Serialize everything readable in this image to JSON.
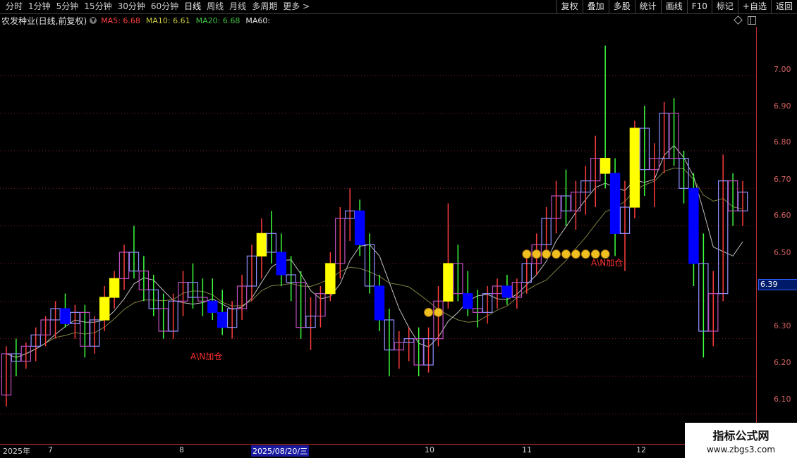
{
  "toolbar": {
    "periods": [
      "分时",
      "1分钟",
      "5分钟",
      "15分钟",
      "30分钟",
      "60分钟",
      "日线",
      "周线",
      "月线",
      "多周期",
      "更多 >"
    ],
    "active_period": "日线",
    "buttons": [
      "复权",
      "叠加",
      "多股",
      "统计",
      "画线",
      "F10",
      "标记",
      "+自选",
      "返回"
    ]
  },
  "info": {
    "stock_title": "农发种业(日线,前复权)",
    "ma5": "MA5: 6.68",
    "ma10": "MA10: 6.61",
    "ma20": "MA20: 6.68",
    "ma60": "MA60:"
  },
  "axis": {
    "dates": [
      "2025年",
      "7",
      "8",
      "10",
      "11",
      "12"
    ],
    "selected_date": "2025/08/20/三",
    "price_ticks": [
      "7.00",
      "6.90",
      "6.80",
      "6.70",
      "6.60",
      "6.50",
      "6.30",
      "6.20",
      "6.10"
    ],
    "current_price": "6.39"
  },
  "chart_data": {
    "type": "candlestick",
    "ylim": [
      6.02,
      7.13
    ],
    "annotations": [
      "A\\N加仓",
      "A\\N加仓"
    ],
    "ma_lines": [
      "MA5",
      "MA10",
      "MA20",
      "MA60"
    ],
    "colors": {
      "up": "#ff3c3c",
      "down": "#3cff3c",
      "box_a": "#c050c0",
      "box_b": "#9090ff",
      "yellow": "#ffff00",
      "blue": "#0000ff",
      "ma": "#a0a060",
      "grid": "#7a2020"
    },
    "ohlc": [
      [
        6.15,
        6.28,
        6.12,
        6.26
      ],
      [
        6.26,
        6.3,
        6.2,
        6.24
      ],
      [
        6.24,
        6.29,
        6.22,
        6.28
      ],
      [
        6.28,
        6.33,
        6.24,
        6.31
      ],
      [
        6.31,
        6.36,
        6.28,
        6.35
      ],
      [
        6.35,
        6.4,
        6.3,
        6.38
      ],
      [
        6.38,
        6.42,
        6.33,
        6.34
      ],
      [
        6.34,
        6.39,
        6.3,
        6.37
      ],
      [
        6.37,
        6.39,
        6.25,
        6.28
      ],
      [
        6.28,
        6.36,
        6.26,
        6.35
      ],
      [
        6.35,
        6.44,
        6.32,
        6.41
      ],
      [
        6.41,
        6.48,
        6.38,
        6.46
      ],
      [
        6.46,
        6.55,
        6.43,
        6.53
      ],
      [
        6.53,
        6.6,
        6.46,
        6.48
      ],
      [
        6.48,
        6.52,
        6.4,
        6.43
      ],
      [
        6.43,
        6.47,
        6.36,
        6.38
      ],
      [
        6.38,
        6.42,
        6.3,
        6.32
      ],
      [
        6.32,
        6.42,
        6.3,
        6.4
      ],
      [
        6.4,
        6.48,
        6.36,
        6.45
      ],
      [
        6.45,
        6.5,
        6.38,
        6.41
      ],
      [
        6.41,
        6.46,
        6.36,
        6.4
      ],
      [
        6.4,
        6.46,
        6.35,
        6.37
      ],
      [
        6.37,
        6.43,
        6.31,
        6.33
      ],
      [
        6.33,
        6.4,
        6.3,
        6.38
      ],
      [
        6.38,
        6.47,
        6.35,
        6.44
      ],
      [
        6.44,
        6.55,
        6.4,
        6.52
      ],
      [
        6.52,
        6.62,
        6.46,
        6.58
      ],
      [
        6.58,
        6.64,
        6.5,
        6.53
      ],
      [
        6.53,
        6.58,
        6.44,
        6.47
      ],
      [
        6.47,
        6.52,
        6.4,
        6.45
      ],
      [
        6.45,
        6.48,
        6.3,
        6.33
      ],
      [
        6.33,
        6.41,
        6.27,
        6.36
      ],
      [
        6.36,
        6.44,
        6.33,
        6.42
      ],
      [
        6.42,
        6.53,
        6.4,
        6.5
      ],
      [
        6.5,
        6.65,
        6.46,
        6.62
      ],
      [
        6.62,
        6.7,
        6.56,
        6.64
      ],
      [
        6.64,
        6.67,
        6.52,
        6.55
      ],
      [
        6.55,
        6.58,
        6.42,
        6.44
      ],
      [
        6.44,
        6.47,
        6.32,
        6.35
      ],
      [
        6.35,
        6.38,
        6.2,
        6.27
      ],
      [
        6.27,
        6.32,
        6.22,
        6.29
      ],
      [
        6.29,
        6.33,
        6.24,
        6.3
      ],
      [
        6.3,
        6.33,
        6.2,
        6.23
      ],
      [
        6.23,
        6.33,
        6.21,
        6.3
      ],
      [
        6.3,
        6.44,
        6.28,
        6.4
      ],
      [
        6.4,
        6.66,
        6.38,
        6.5
      ],
      [
        6.5,
        6.55,
        6.4,
        6.42
      ],
      [
        6.42,
        6.48,
        6.36,
        6.38
      ],
      [
        6.38,
        6.43,
        6.33,
        6.37
      ],
      [
        6.37,
        6.44,
        6.34,
        6.42
      ],
      [
        6.42,
        6.46,
        6.38,
        6.44
      ],
      [
        6.44,
        6.47,
        6.39,
        6.41
      ],
      [
        6.41,
        6.46,
        6.38,
        6.45
      ],
      [
        6.45,
        6.52,
        6.42,
        6.5
      ],
      [
        6.5,
        6.58,
        6.47,
        6.55
      ],
      [
        6.55,
        6.65,
        6.52,
        6.62
      ],
      [
        6.62,
        6.72,
        6.58,
        6.68
      ],
      [
        6.68,
        6.75,
        6.6,
        6.64
      ],
      [
        6.64,
        6.72,
        6.59,
        6.69
      ],
      [
        6.69,
        6.76,
        6.63,
        6.72
      ],
      [
        6.72,
        6.84,
        6.65,
        6.78
      ],
      [
        6.78,
        7.08,
        6.7,
        6.74
      ],
      [
        6.74,
        6.78,
        6.52,
        6.58
      ],
      [
        6.58,
        6.72,
        6.48,
        6.65
      ],
      [
        6.65,
        6.88,
        6.62,
        6.86
      ],
      [
        6.86,
        6.92,
        6.68,
        6.75
      ],
      [
        6.75,
        6.82,
        6.65,
        6.78
      ],
      [
        6.78,
        6.93,
        6.74,
        6.9
      ],
      [
        6.9,
        6.94,
        6.76,
        6.78
      ],
      [
        6.78,
        6.8,
        6.66,
        6.7
      ],
      [
        6.7,
        6.74,
        6.44,
        6.5
      ],
      [
        6.5,
        6.58,
        6.25,
        6.32
      ],
      [
        6.32,
        6.48,
        6.28,
        6.42
      ],
      [
        6.42,
        6.79,
        6.4,
        6.72
      ],
      [
        6.72,
        6.74,
        6.6,
        6.64
      ],
      [
        6.64,
        6.72,
        6.6,
        6.69
      ]
    ]
  }
}
